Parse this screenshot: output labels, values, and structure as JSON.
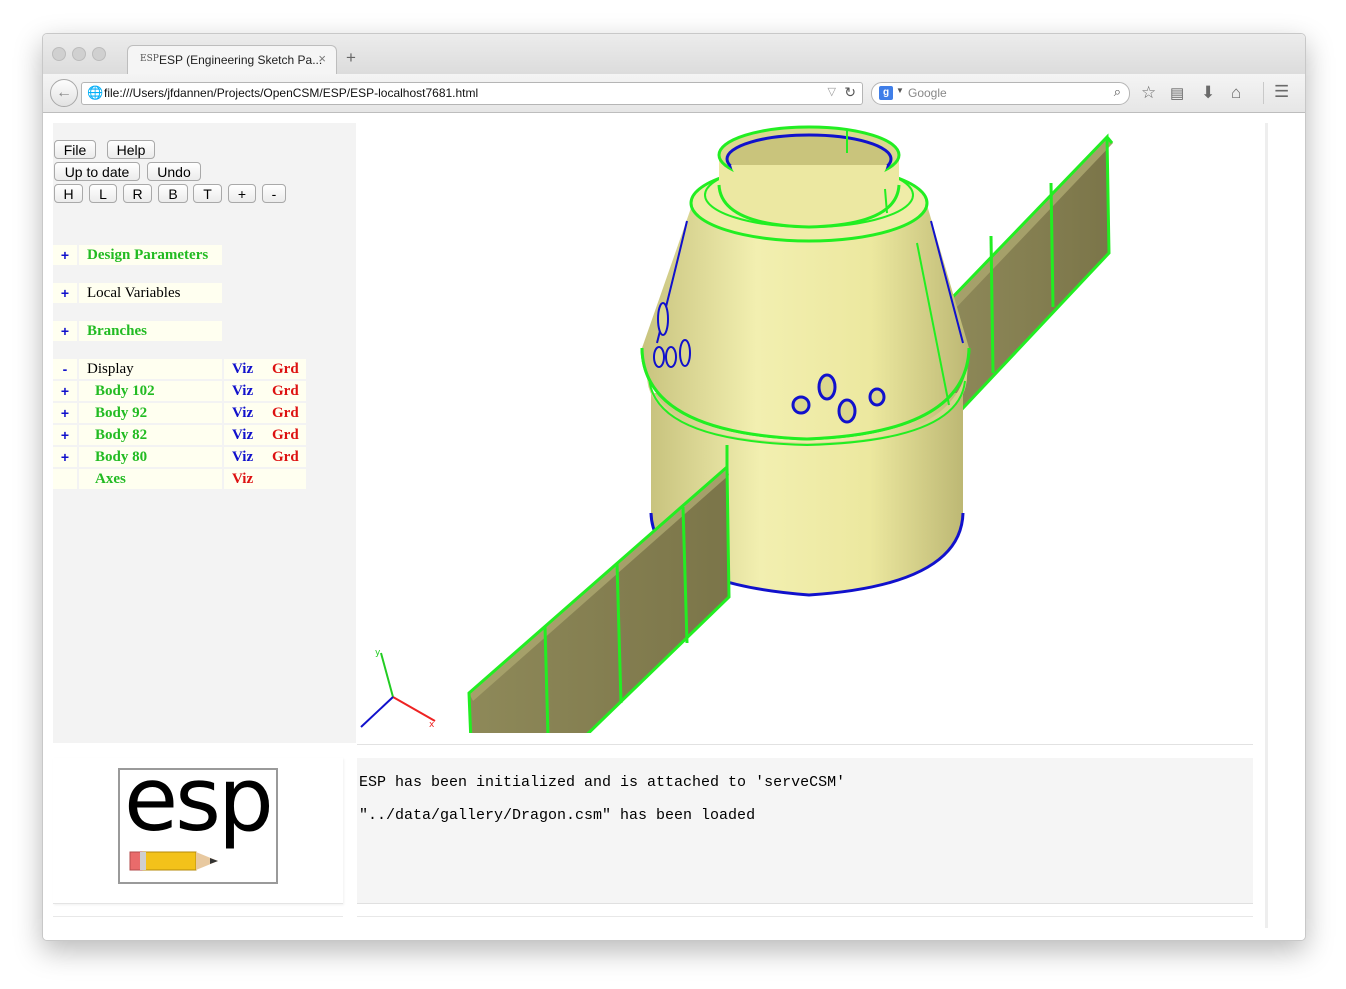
{
  "browser": {
    "tab_title": "ESP (Engineering Sketch Pa...",
    "favicon_text": "ESP",
    "tab_close": "×",
    "new_tab": "+",
    "back": "←",
    "url": "file:///Users/jfdannen/Projects/OpenCSM/ESP/ESP-localhost7681.html",
    "search_engine_letter": "g",
    "search_placeholder": "Google",
    "icons": [
      "bookmark-star-icon",
      "reading-list-icon",
      "download-icon",
      "home-icon",
      "menu-icon"
    ]
  },
  "toolbar": {
    "file": "File",
    "help": "Help",
    "up_to_date": "Up to date",
    "undo": "Undo",
    "view_buttons": [
      "H",
      "L",
      "R",
      "B",
      "T",
      "+",
      "-"
    ]
  },
  "tree": {
    "design_parameters": {
      "sign": "+",
      "label": "Design Parameters"
    },
    "local_variables": {
      "sign": "+",
      "label": "Local Variables"
    },
    "branches": {
      "sign": "+",
      "label": "Branches"
    },
    "display": {
      "sign": "-",
      "label": "Display",
      "viz": "Viz",
      "grd": "Grd"
    },
    "bodies": [
      {
        "sign": "+",
        "label": "Body 102",
        "viz": "Viz",
        "grd": "Grd"
      },
      {
        "sign": "+",
        "label": "Body 92",
        "viz": "Viz",
        "grd": "Grd"
      },
      {
        "sign": "+",
        "label": "Body 82",
        "viz": "Viz",
        "grd": "Grd"
      },
      {
        "sign": "+",
        "label": "Body 80",
        "viz": "Viz",
        "grd": "Grd"
      }
    ],
    "axes": {
      "label": "Axes",
      "viz": "Viz"
    }
  },
  "colors": {
    "tree_label_green": "#22bb22",
    "sign_blue": "#1111cc",
    "viz_blue": "#1111cc",
    "grd_red": "#dd1111",
    "axes_viz_red": "#dd1111",
    "model_fill": "#e6e39a",
    "panel_fill": "#857f52",
    "edge_green": "#22ee22",
    "edge_blue": "#1111cc"
  },
  "logo": {
    "text": "esp"
  },
  "messages": [
    "ESP has been initialized and is attached to 'serveCSM'",
    "\"../data/gallery/Dragon.csm\" has been loaded"
  ]
}
